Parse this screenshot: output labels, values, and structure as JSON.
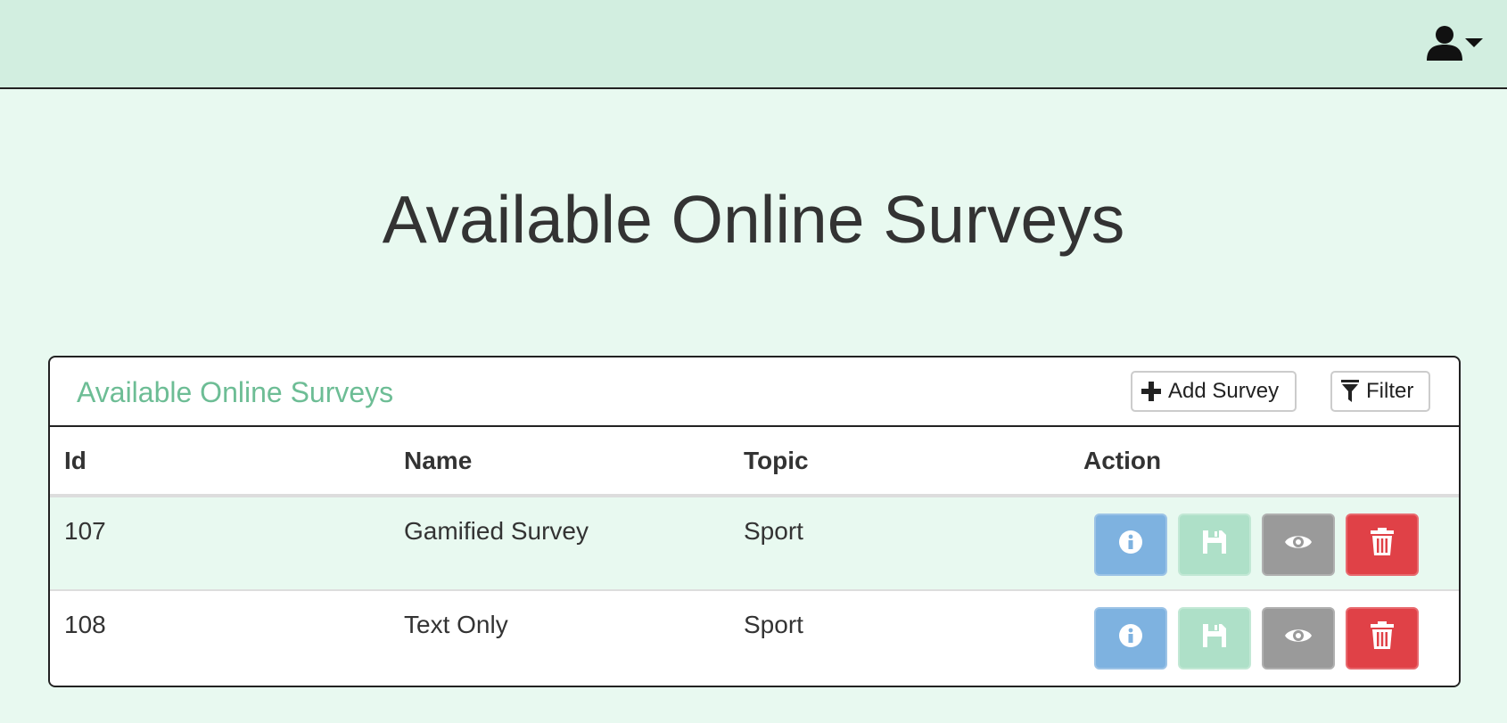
{
  "header": {
    "user_icon": "user-icon",
    "dropdown_icon": "caret-down-icon"
  },
  "page": {
    "title": "Available Online Surveys"
  },
  "panel": {
    "title": "Available Online Surveys",
    "add_button_label": "Add Survey",
    "add_button_icon": "plus-icon",
    "filter_button_label": "Filter",
    "filter_button_icon": "filter-icon"
  },
  "table": {
    "columns": [
      "Id",
      "Name",
      "Topic",
      "Action"
    ],
    "rows": [
      {
        "id": "107",
        "name": "Gamified Survey",
        "topic": "Sport"
      },
      {
        "id": "108",
        "name": "Text Only",
        "topic": "Sport"
      }
    ],
    "action_icons": [
      "info-icon",
      "save-icon",
      "eye-icon",
      "trash-icon"
    ]
  },
  "colors": {
    "topbar": "#d2eee0",
    "background": "#e8f9f0",
    "panel_title": "#6dbd95",
    "info_button": "#7eb2e0",
    "save_button": "#aee0c8",
    "view_button": "#9a9a9a",
    "delete_button": "#e04147"
  }
}
